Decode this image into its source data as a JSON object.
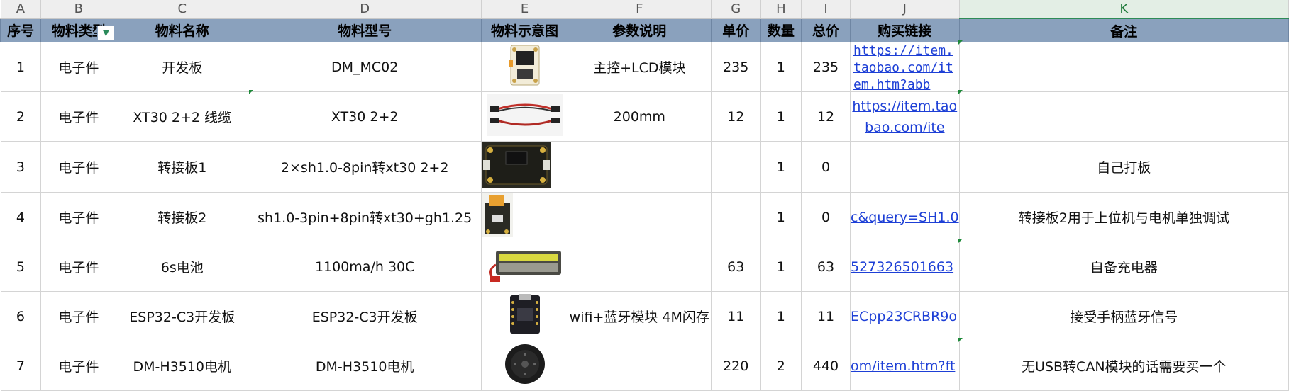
{
  "column_letters": [
    "A",
    "B",
    "C",
    "D",
    "E",
    "F",
    "G",
    "H",
    "I",
    "J",
    "K"
  ],
  "selected_column": "K",
  "headers": [
    "序号",
    "物料类型",
    "物料名称",
    "物料型号",
    "物料示意图",
    "参数说明",
    "单价",
    "数量",
    "总价",
    "购买链接",
    "备注"
  ],
  "filter_icon": "filter-dropdown-icon",
  "rows": [
    {
      "no": "1",
      "type": "电子件",
      "name": "开发板",
      "model": "DM_MC02",
      "image": "dev-board-image",
      "param": "主控+LCD模块",
      "price": "235",
      "qty": "1",
      "total": "235",
      "link": "https://item.taobao.com/item.htm?abb",
      "note": ""
    },
    {
      "no": "2",
      "type": "电子件",
      "name": "XT30 2+2 线缆",
      "model": "XT30 2+2",
      "image": "xt30-cable-image",
      "param": "200mm",
      "price": "12",
      "qty": "1",
      "total": "12",
      "link": "https://item.taobao.com/ite",
      "note": ""
    },
    {
      "no": "3",
      "type": "电子件",
      "name": "转接板1",
      "model": "2×sh1.0-8pin转xt30 2+2",
      "image": "adapter-board1-image",
      "param": "",
      "price": "",
      "qty": "1",
      "total": "0",
      "link": "",
      "note": "自己打板"
    },
    {
      "no": "4",
      "type": "电子件",
      "name": "转接板2",
      "model": "sh1.0-3pin+8pin转xt30+gh1.25",
      "image": "adapter-board2-image",
      "param": "",
      "price": "",
      "qty": "1",
      "total": "0",
      "link": "c&query=SH1.0",
      "note": "转接板2用于上位机与电机单独调试"
    },
    {
      "no": "5",
      "type": "电子件",
      "name": "6s电池",
      "model": "1100ma/h 30C",
      "image": "battery-image",
      "param": "",
      "price": "63",
      "qty": "1",
      "total": "63",
      "link": "527326501663",
      "note": "自备充电器"
    },
    {
      "no": "6",
      "type": "电子件",
      "name": "ESP32-C3开发板",
      "model": "ESP32-C3开发板",
      "image": "esp32-board-image",
      "param": "wifi+蓝牙模块 4M闪存",
      "price": "11",
      "qty": "1",
      "total": "11",
      "link": "ECpp23CRBR9o",
      "note": "接受手柄蓝牙信号"
    },
    {
      "no": "7",
      "type": "电子件",
      "name": "DM-H3510电机",
      "model": "DM-H3510电机",
      "image": "motor-image",
      "param": "",
      "price": "220",
      "qty": "2",
      "total": "440",
      "link": "om/item.htm?ft",
      "note": "无USB转CAN模块的话需要买一个"
    }
  ],
  "colors": {
    "header_bg": "#8aa1bd",
    "link": "#1d3fd6",
    "selected_col": "#e3eee5",
    "grid": "#d4d4d4"
  }
}
